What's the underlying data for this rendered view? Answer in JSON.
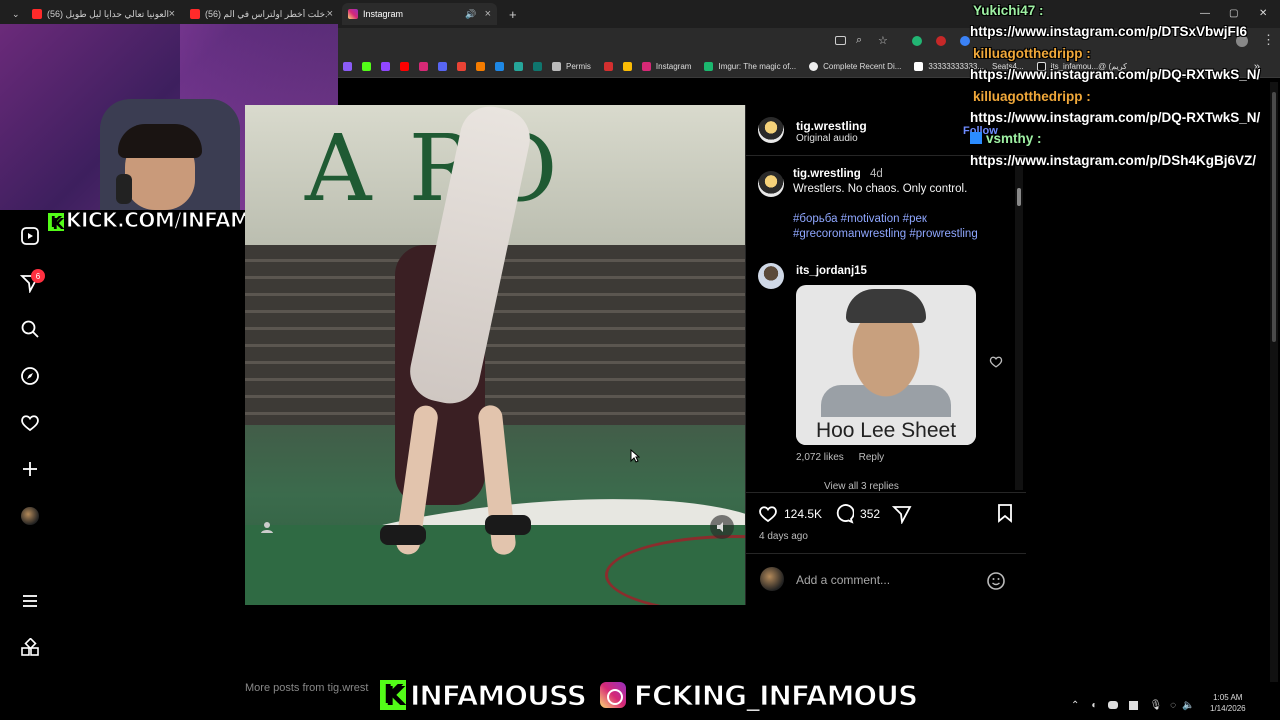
{
  "tabs": [
    {
      "label": "(56) العونيا تعالي حدايا ليل طويل",
      "close": "×"
    },
    {
      "label": "(56) دخلت أخطر اولتراس في الم",
      "close": "×"
    },
    {
      "label": "Instagram",
      "close": "×"
    }
  ],
  "new_tab": "+",
  "window_controls": {
    "minimize": "—",
    "maximize": "▢",
    "close": "✕"
  },
  "bookmarks": [
    "Permis",
    "Instagram",
    "Imgur: The magic of...",
    "Complete Recent Di...",
    "33333333333...",
    "Seats4...",
    "its_infamou...@ (كريم"
  ],
  "bookmarks_more": "»",
  "stream_overlay": {
    "kick_url": "KICK.COM/INFAMOUSS",
    "k": "K",
    "banner_kick": "INFAMOUSS",
    "banner_ig": "FCKING_INFAMOUS"
  },
  "sidenav": {
    "notification_count": "6"
  },
  "post": {
    "username": "tig.wrestling",
    "audio": "Original audio",
    "follow": "Follow",
    "caption_user": "tig.wrestling",
    "caption_age": "4d",
    "caption_text": "Wrestlers. No chaos. Only control.",
    "hashtags": "#борьба #motivation #рек #grecoromanwrestling #prowrestling",
    "comment_user": "its_jordanj15",
    "meme_caption": "Hoo Lee Sheet",
    "comment_likes": "2,072 likes",
    "comment_reply": "Reply",
    "view_replies": "View all 3 replies",
    "likes": "124.5K",
    "comments": "352",
    "posted": "4 days ago",
    "add_comment": "Add a comment..."
  },
  "more_posts": "More posts from tig.wrest",
  "chat": [
    {
      "name": "Yukichi47 :",
      "color": "#9ef0a3",
      "msg": "https://www.instagram.com/p/DTSxVbwjFI6"
    },
    {
      "name": "killuagotthedripp :",
      "color": "#f0a83a",
      "msg": "https://www.instagram.com/p/DQ-RXTwkS_N/"
    },
    {
      "name": "killuagotthedripp :",
      "color": "#f0a83a",
      "msg": "https://www.instagram.com/p/DQ-RXTwkS_N/"
    },
    {
      "name": "vsmthy :",
      "color": "#9ef0a3",
      "msg": "https://www.instagram.com/p/DSh4KgBj6VZ/"
    }
  ],
  "clock": {
    "time": "1:05 AM",
    "date": "1/14/2026"
  }
}
